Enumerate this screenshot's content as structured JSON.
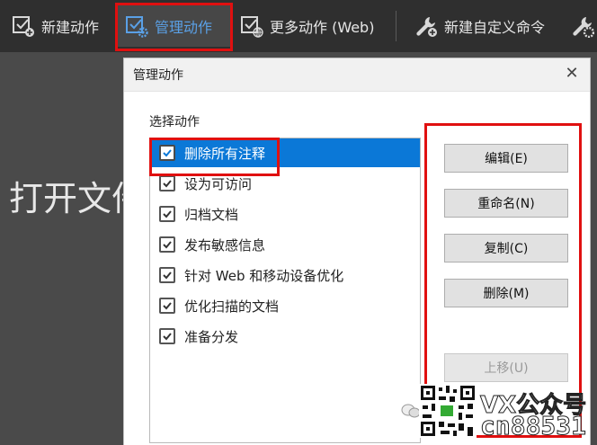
{
  "toolbar": {
    "items": [
      {
        "label": "新建动作",
        "icon": "new-action-icon"
      },
      {
        "label": "管理动作",
        "icon": "manage-action-icon",
        "active": true
      },
      {
        "label": "更多动作 (Web)",
        "icon": "web-action-icon"
      },
      {
        "label": "新建自定义命令",
        "icon": "wrench-icon"
      }
    ]
  },
  "background": {
    "text": "打开文件"
  },
  "dialog": {
    "title": "管理动作",
    "list_label": "选择动作",
    "items": [
      {
        "label": "删除所有注释",
        "checked": true,
        "selected": true
      },
      {
        "label": "设为可访问",
        "checked": true
      },
      {
        "label": "归档文档",
        "checked": true
      },
      {
        "label": "发布敏感信息",
        "checked": true
      },
      {
        "label": "针对 Web 和移动设备优化",
        "checked": true
      },
      {
        "label": "优化扫描的文档",
        "checked": true
      },
      {
        "label": "准备分发",
        "checked": true
      }
    ],
    "buttons": {
      "edit": "编辑(E)",
      "rename": "重命名(N)",
      "copy": "复制(C)",
      "delete": "删除(M)",
      "move_up": "上移(U)"
    }
  },
  "watermark": {
    "line1": "VX公众号",
    "line2": "cn88531"
  },
  "colors": {
    "accent": "#0b78d7",
    "highlight": "#e01010",
    "toolbar": "#2f2f2f"
  }
}
